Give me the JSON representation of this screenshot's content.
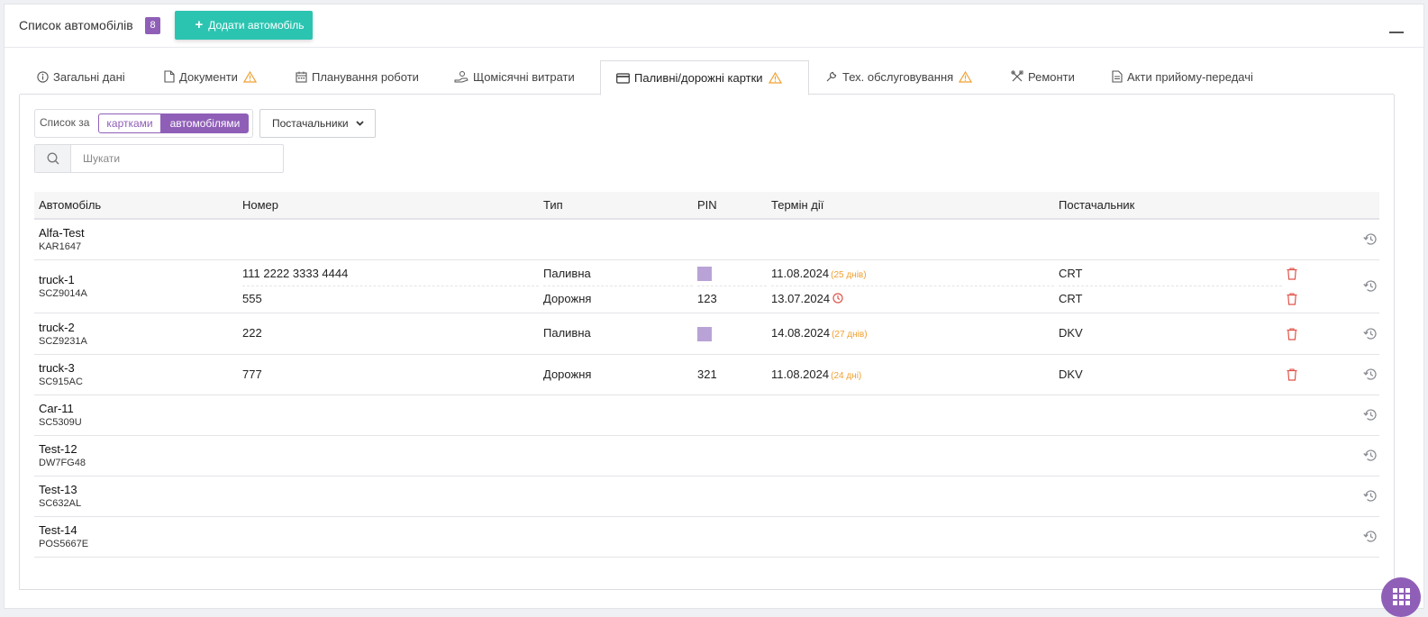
{
  "header": {
    "title": "Список автомобілів",
    "count": "8",
    "add_button": "Додати автомобіль"
  },
  "tabs": [
    {
      "label": "Загальні дані",
      "icon": "info-icon",
      "warning": false
    },
    {
      "label": "Документи",
      "icon": "document-icon",
      "warning": true
    },
    {
      "label": "Планування роботи",
      "icon": "calendar-icon",
      "warning": false
    },
    {
      "label": "Щомісячні витрати",
      "icon": "expenses-icon",
      "warning": false
    },
    {
      "label": "Паливні/дорожні картки",
      "icon": "card-icon",
      "warning": true,
      "active": true
    },
    {
      "label": "Тех. обслуговування",
      "icon": "wrench-icon",
      "warning": true
    },
    {
      "label": "Ремонти",
      "icon": "tools-icon",
      "warning": false
    },
    {
      "label": "Акти прийому-передачі",
      "icon": "act-document-icon",
      "warning": false
    }
  ],
  "filters": {
    "list_by_label": "Список за",
    "by_cards": "картками",
    "by_cars": "автомобілями",
    "active_toggle": "автомобілями",
    "suppliers_dropdown": "Постачальники",
    "search_placeholder": "Шукати"
  },
  "table": {
    "columns": [
      "Автомобіль",
      "Номер",
      "Тип",
      "PIN",
      "Термін дії",
      "Постачальник"
    ],
    "rows": [
      {
        "car": "Alfa-Test",
        "plate": "KAR1647",
        "cards": []
      },
      {
        "car": "truck-1",
        "plate": "SCZ9014A",
        "cards": [
          {
            "number": "111 2222 3333 4444",
            "type": "Паливна",
            "pin": "",
            "pin_hidden": true,
            "expiry": "11.08.2024",
            "days": "(25 днів)",
            "expired": false,
            "supplier": "CRT"
          },
          {
            "number": "555",
            "type": "Дорожня",
            "pin": "123",
            "pin_hidden": false,
            "expiry": "13.07.2024",
            "days": "",
            "expired": true,
            "supplier": "CRT"
          }
        ]
      },
      {
        "car": "truck-2",
        "plate": "SCZ9231A",
        "cards": [
          {
            "number": "222",
            "type": "Паливна",
            "pin": "",
            "pin_hidden": true,
            "expiry": "14.08.2024",
            "days": "(27 днів)",
            "expired": false,
            "supplier": "DKV"
          }
        ]
      },
      {
        "car": "truck-3",
        "plate": "SC915AC",
        "cards": [
          {
            "number": "777",
            "type": "Дорожня",
            "pin": "321",
            "pin_hidden": false,
            "expiry": "11.08.2024",
            "days": "(24 дні)",
            "expired": false,
            "supplier": "DKV"
          }
        ]
      },
      {
        "car": "Car-11",
        "plate": "SC5309U",
        "cards": []
      },
      {
        "car": "Test-12",
        "plate": "DW7FG48",
        "cards": []
      },
      {
        "car": "Test-13",
        "plate": "SC632AL",
        "cards": []
      },
      {
        "car": "Test-14",
        "plate": "POS5667E",
        "cards": []
      }
    ]
  },
  "colors": {
    "accent_purple": "#8f5fb8",
    "teal": "#2bc4b1",
    "warning": "#f0a030",
    "danger": "#e0534a"
  }
}
